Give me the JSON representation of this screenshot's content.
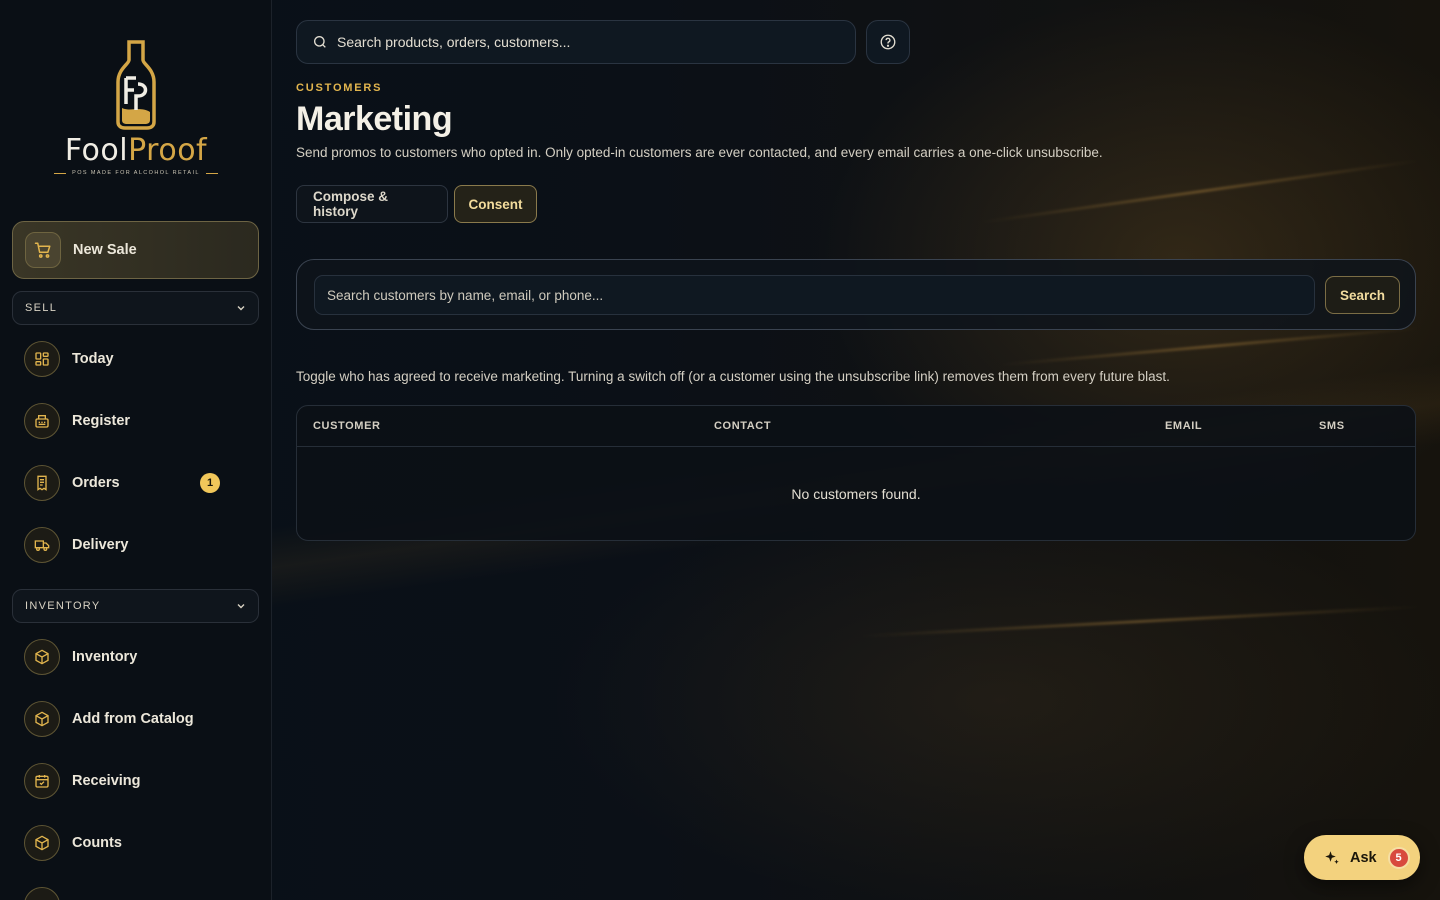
{
  "brand": {
    "name_part1": "Fool",
    "name_part2": "Proof",
    "tagline": "POS MADE FOR ALCOHOL RETAIL",
    "accent": "#d4a646"
  },
  "top_search": {
    "placeholder": "Search products, orders, customers..."
  },
  "sidebar": {
    "new_sale": {
      "label": "New Sale",
      "icon": "cart-icon"
    },
    "sections": [
      {
        "label": "SELL",
        "items": [
          {
            "label": "Today",
            "icon": "dashboard-icon"
          },
          {
            "label": "Register",
            "icon": "register-icon"
          },
          {
            "label": "Orders",
            "icon": "receipt-icon",
            "badge": "1"
          },
          {
            "label": "Delivery",
            "icon": "truck-icon"
          }
        ]
      },
      {
        "label": "INVENTORY",
        "items": [
          {
            "label": "Inventory",
            "icon": "box-icon"
          },
          {
            "label": "Add from Catalog",
            "icon": "box-icon"
          },
          {
            "label": "Receiving",
            "icon": "calendar-check-icon"
          },
          {
            "label": "Counts",
            "icon": "box-icon"
          }
        ]
      }
    ]
  },
  "page": {
    "eyebrow": "CUSTOMERS",
    "title": "Marketing",
    "subtitle": "Send promos to customers who opted in. Only opted-in customers are ever contacted, and every email carries a one-click unsubscribe.",
    "tabs": [
      {
        "label": "Compose & history",
        "active": false
      },
      {
        "label": "Consent",
        "active": true
      }
    ]
  },
  "customer_search": {
    "placeholder": "Search customers by name, email, or phone...",
    "button_label": "Search"
  },
  "consent": {
    "hint": "Toggle who has agreed to receive marketing. Turning a switch off (or a customer using the unsubscribe link) removes them from every future blast.",
    "columns": [
      "CUSTOMER",
      "CONTACT",
      "EMAIL",
      "SMS"
    ],
    "empty_text": "No customers found."
  },
  "assistant": {
    "label": "Ask",
    "badge": "5"
  }
}
